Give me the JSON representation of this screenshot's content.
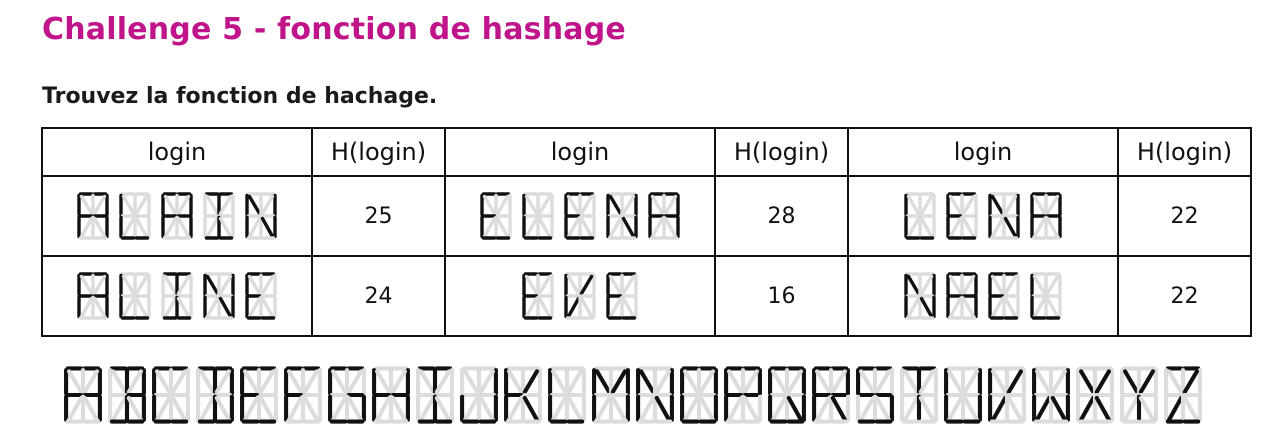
{
  "header": {
    "title": "Challenge 5 - fonction de hashage",
    "subtitle": "Trouvez la fonction de hachage."
  },
  "table": {
    "headers": [
      "login",
      "H(login)",
      "login",
      "H(login)",
      "login",
      "H(login)"
    ],
    "rows": [
      [
        {
          "login": "ALAIN",
          "hash": "25"
        },
        {
          "login": "ELENA",
          "hash": "28"
        },
        {
          "login": "LENA",
          "hash": "22"
        }
      ],
      [
        {
          "login": "ALINE",
          "hash": "24"
        },
        {
          "login": "EVE",
          "hash": "16"
        },
        {
          "login": "NAEL",
          "hash": "22"
        }
      ]
    ]
  },
  "alphabet": "ABCDEFGHIJKLMNOPQRSTUVWXYZ",
  "colors": {
    "title": "#c0158a",
    "segment_on": "#111111",
    "segment_off": "#dcdcdc"
  }
}
